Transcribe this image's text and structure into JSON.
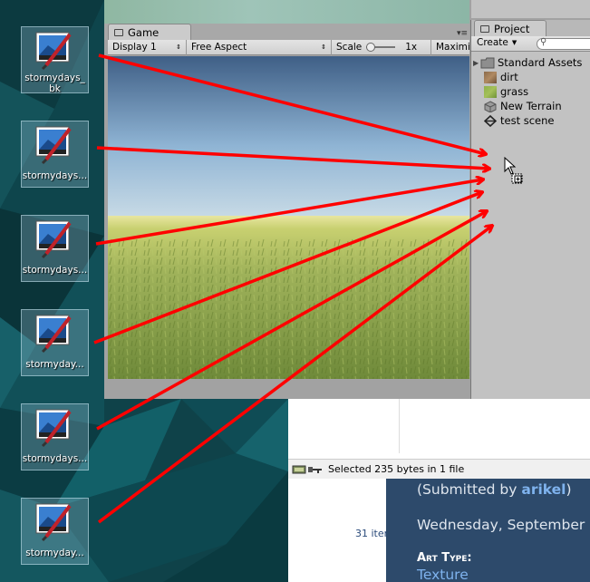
{
  "desktop": {
    "icons": [
      {
        "label": "stormydays_\nbk",
        "icon": "paint-image-icon"
      },
      {
        "label": "stormydays...",
        "icon": "paint-image-icon"
      },
      {
        "label": "stormydays...",
        "icon": "paint-image-icon"
      },
      {
        "label": "stormyday...",
        "icon": "paint-image-icon"
      },
      {
        "label": "stormydays...",
        "icon": "paint-image-icon"
      },
      {
        "label": "stormyday...",
        "icon": "paint-image-icon"
      }
    ]
  },
  "unity": {
    "game_tab": "Game",
    "game_toolbar": {
      "display": "Display 1",
      "aspect": "Free Aspect",
      "scale_label": "Scale",
      "scale_value": "1x",
      "maximize": "Maximi"
    },
    "project_tab": "Project",
    "project_create": "Create",
    "project_items": [
      {
        "label": "Standard Assets",
        "icon": "folder-icon",
        "expandable": true
      },
      {
        "label": "dirt",
        "icon": "texture-dirt-icon",
        "expandable": false
      },
      {
        "label": "grass",
        "icon": "texture-grass-icon",
        "expandable": false
      },
      {
        "label": "New Terrain",
        "icon": "terrain-asset-icon",
        "expandable": false
      },
      {
        "label": "test scene",
        "icon": "unity-scene-icon",
        "expandable": false
      }
    ]
  },
  "browser": {
    "status_text": "Selected 235 bytes in 1 file",
    "items_count": "31 iter"
  },
  "site": {
    "submitted_prefix": "(Submitted by ",
    "submitted_user": "arikel",
    "submitted_suffix": ")",
    "date": "Wednesday, September",
    "art_type_label": "Art Type:",
    "art_type_value": "Texture"
  },
  "colors": {
    "arrow": "#ff0000",
    "site_bg": "#2d4a6b",
    "link": "#7fb3ee"
  }
}
